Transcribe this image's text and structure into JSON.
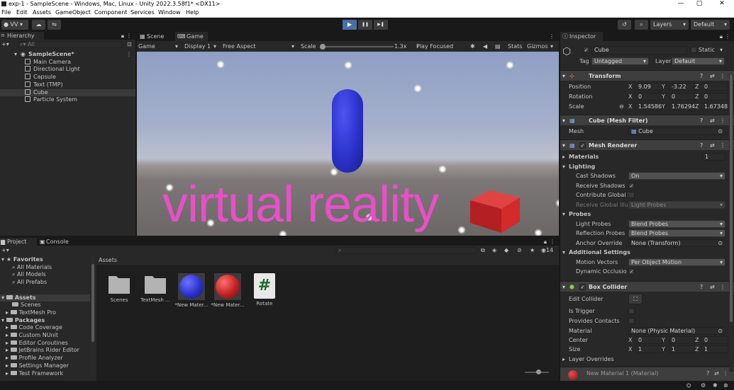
{
  "window": {
    "title": "exp-1 - SampleScene - Windows, Mac, Linux - Unity 2022.3.58f1* <DX11>",
    "minimize": "—",
    "maximize": "▢",
    "close": "✕"
  },
  "menu": [
    "File",
    "Edit",
    "Assets",
    "GameObject",
    "Component",
    "Services",
    "Window",
    "Help"
  ],
  "toolbar": {
    "account": "VV",
    "play": "▶",
    "pause": "❚❚",
    "step": "▶❚",
    "layers": "Layers",
    "layout": "Default"
  },
  "hierarchy": {
    "tab": "Hierarchy",
    "search_placeholder": "All",
    "scene": "SampleScene*",
    "items": [
      "Main Camera",
      "Directional Light",
      "Capsule",
      "Text (TMP)",
      "Cube",
      "Particle System"
    ],
    "selected": "Cube"
  },
  "tabs": {
    "scene": "Scene",
    "game": "Game"
  },
  "game_toolbar": {
    "mode": "Game",
    "display": "Display 1",
    "aspect": "Free Aspect",
    "scale_label": "Scale",
    "scale_value": "1.3x",
    "play_focused": "Play Focused",
    "stats": "Stats",
    "gizmos": "Gizmos"
  },
  "game_view": {
    "text": "virtual reality",
    "text_color": "#e84fc9",
    "capsule_color": "#2b31c9",
    "cube_color": "#d42a2a"
  },
  "inspector": {
    "tab": "Inspector",
    "object_name": "Cube",
    "static_label": "Static",
    "tag_label": "Tag",
    "tag_value": "Untagged",
    "layer_label": "Layer",
    "layer_value": "Default",
    "transform": {
      "title": "Transform",
      "position_label": "Position",
      "rotation_label": "Rotation",
      "scale_label": "Scale",
      "position": [
        "9.09",
        "-3.22",
        "0"
      ],
      "rotation": [
        "0",
        "0",
        "0"
      ],
      "scale": [
        "1.54586",
        "1.76294",
        "1.67348"
      ]
    },
    "mesh_filter": {
      "title": "Cube (Mesh Filter)",
      "mesh_label": "Mesh",
      "mesh_value": "Cube"
    },
    "mesh_renderer": {
      "title": "Mesh Renderer",
      "materials_label": "Materials",
      "materials_count": "1",
      "lighting_label": "Lighting",
      "cast_shadows_label": "Cast Shadows",
      "cast_shadows_value": "On",
      "receive_shadows_label": "Receive Shadows",
      "contribute_gi_label": "Contribute Global I",
      "receive_gi_label": "Receive Global Illu",
      "receive_gi_value": "Light Probes",
      "probes_label": "Probes",
      "light_probes_label": "Light Probes",
      "light_probes_value": "Blend Probes",
      "reflection_probes_label": "Reflection Probes",
      "reflection_probes_value": "Blend Probes",
      "anchor_override_label": "Anchor Override",
      "anchor_override_value": "None (Transform)",
      "additional_label": "Additional Settings",
      "motion_vectors_label": "Motion Vectors",
      "motion_vectors_value": "Per Object Motion",
      "dynamic_occlusion_label": "Dynamic Occlusio"
    },
    "box_collider": {
      "title": "Box Collider",
      "edit_collider_label": "Edit Collider",
      "is_trigger_label": "Is Trigger",
      "provides_contacts_label": "Provides Contacts",
      "material_label": "Material",
      "material_value": "None (Physic Material)",
      "center_label": "Center",
      "size_label": "Size",
      "center": [
        "0",
        "0",
        "0"
      ],
      "size": [
        "1",
        "1",
        "1"
      ],
      "layer_overrides_label": "Layer Overrides"
    },
    "material_footer": "New Material 1 (Material)"
  },
  "project": {
    "tab_project": "Project",
    "tab_console": "Console",
    "favorites_label": "Favorites",
    "favorites": [
      "All Materials",
      "All Models",
      "All Prefabs"
    ],
    "assets_label": "Assets",
    "asset_folders": [
      "Scenes",
      "TextMesh Pro"
    ],
    "packages_label": "Packages",
    "packages": [
      "Code Coverage",
      "Custom NUnit",
      "Editor Coroutines",
      "JetBrains Rider Editor",
      "Profile Analyzer",
      "Settings Manager",
      "Test Framework"
    ],
    "breadcrumb": "Assets",
    "hidden_count": "14",
    "grid": [
      {
        "name": "Scenes",
        "kind": "folder"
      },
      {
        "name": "TextMesh ...",
        "kind": "folder"
      },
      {
        "name": "*New Mater...",
        "kind": "material-blue"
      },
      {
        "name": "*New Mater...",
        "kind": "material-red"
      },
      {
        "name": "Rotate",
        "kind": "script"
      }
    ]
  }
}
